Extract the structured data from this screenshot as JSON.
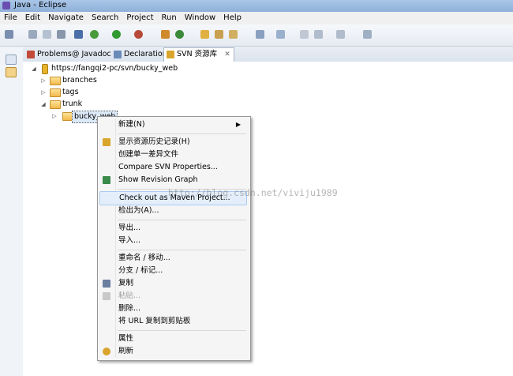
{
  "window": {
    "title": "Java - Eclipse"
  },
  "menubar": {
    "items": [
      "File",
      "Edit",
      "Navigate",
      "Search",
      "Project",
      "Run",
      "Window",
      "Help"
    ]
  },
  "tabs": [
    {
      "label": "Problems",
      "icon": "problems-icon"
    },
    {
      "label": "@ Javadoc",
      "icon": ""
    },
    {
      "label": "Declaration",
      "icon": "declaration-icon"
    },
    {
      "label": "SVN 资源库",
      "icon": "svn-repo-icon",
      "active": true,
      "close": "✕"
    }
  ],
  "tree": {
    "root": "https://fangqi2-pc/svn/bucky_web",
    "branches": "branches",
    "tags": "tags",
    "trunk": "trunk",
    "selected": "bucky_web"
  },
  "context_menu": {
    "items": [
      {
        "label": "新建(N)",
        "submenu": "▶"
      },
      {
        "label": "显示资源历史记录(H)",
        "icon": "history-icon"
      },
      {
        "label": "创建单一差异文件"
      },
      {
        "label": "Compare SVN Properties..."
      },
      {
        "label": "Show Revision Graph",
        "icon": "revision-graph-icon"
      },
      {
        "label": "Check out as Maven Project..."
      },
      {
        "label": "检出为(A)..."
      },
      {
        "label": "导出..."
      },
      {
        "label": "导入..."
      },
      {
        "label": "重命名 / 移动..."
      },
      {
        "label": "分支 / 标记..."
      },
      {
        "label": "复制",
        "icon": "copy-icon"
      },
      {
        "label": "粘贴...",
        "icon": "paste-icon",
        "disabled": true
      },
      {
        "label": "删除..."
      },
      {
        "label": "将 URL 复制到剪贴板"
      },
      {
        "label": "属性"
      },
      {
        "label": "刷新",
        "icon": "refresh-icon"
      }
    ]
  },
  "watermark": "http://blog.csdn.net/viviju1989",
  "colors": {
    "accent": "#a9c6e8",
    "folder": "#f2b94a",
    "hover": "#e3eefa"
  }
}
